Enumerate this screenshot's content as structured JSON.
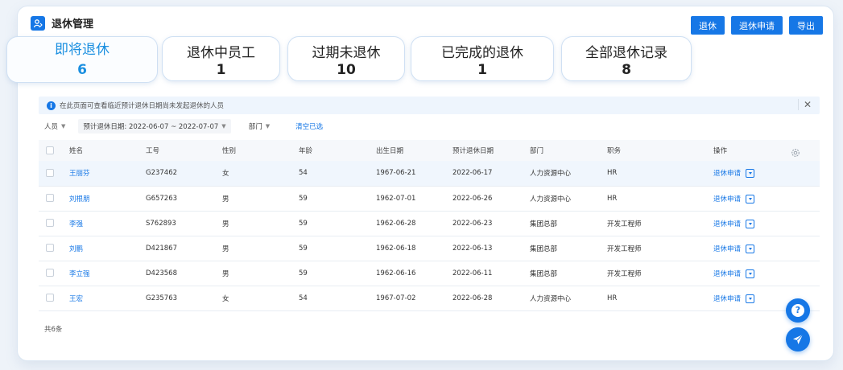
{
  "app": {
    "title": "退休管理"
  },
  "toolbar": {
    "retire_label": "退休",
    "apply_label": "退休申请",
    "export_label": "导出"
  },
  "tabs": [
    {
      "label": "即将退休",
      "count": "6",
      "active": true
    },
    {
      "label": "退休中员工",
      "count": "1"
    },
    {
      "label": "过期未退休",
      "count": "10"
    },
    {
      "label": "已完成的退休",
      "count": "1"
    },
    {
      "label": "全部退休记录",
      "count": "8"
    }
  ],
  "info": {
    "text": "在此页面可查看临近预计退休日期尚未发起退休的人员"
  },
  "filters": {
    "person_label": "人员",
    "date_label": "预计退休日期: 2022-06-07 ~ 2022-07-07",
    "dept_label": "部门",
    "clear_label": "清空已选"
  },
  "table": {
    "headers": [
      "姓名",
      "工号",
      "性别",
      "年龄",
      "出生日期",
      "预计退休日期",
      "部门",
      "职务",
      "操作"
    ],
    "action_label": "退休申请",
    "rows": [
      {
        "name": "王丽芬",
        "id": "G237462",
        "gender": "女",
        "age": "54",
        "birth": "1967-06-21",
        "retire": "2022-06-17",
        "dept": "人力资源中心",
        "position": "HR"
      },
      {
        "name": "刘根朋",
        "id": "G657263",
        "gender": "男",
        "age": "59",
        "birth": "1962-07-01",
        "retire": "2022-06-26",
        "dept": "人力资源中心",
        "position": "HR"
      },
      {
        "name": "李强",
        "id": "S762893",
        "gender": "男",
        "age": "59",
        "birth": "1962-06-28",
        "retire": "2022-06-23",
        "dept": "集团总部",
        "position": "开发工程师"
      },
      {
        "name": "刘鹏",
        "id": "D421867",
        "gender": "男",
        "age": "59",
        "birth": "1962-06-18",
        "retire": "2022-06-13",
        "dept": "集团总部",
        "position": "开发工程师"
      },
      {
        "name": "李立强",
        "id": "D423568",
        "gender": "男",
        "age": "59",
        "birth": "1962-06-16",
        "retire": "2022-06-11",
        "dept": "集团总部",
        "position": "开发工程师"
      },
      {
        "name": "王宏",
        "id": "G235763",
        "gender": "女",
        "age": "54",
        "birth": "1967-07-02",
        "retire": "2022-06-28",
        "dept": "人力资源中心",
        "position": "HR"
      }
    ]
  },
  "footer": {
    "count_text": "共6条"
  },
  "colors": {
    "accent": "#1677e6",
    "active_tab": "#1a8fe0"
  }
}
